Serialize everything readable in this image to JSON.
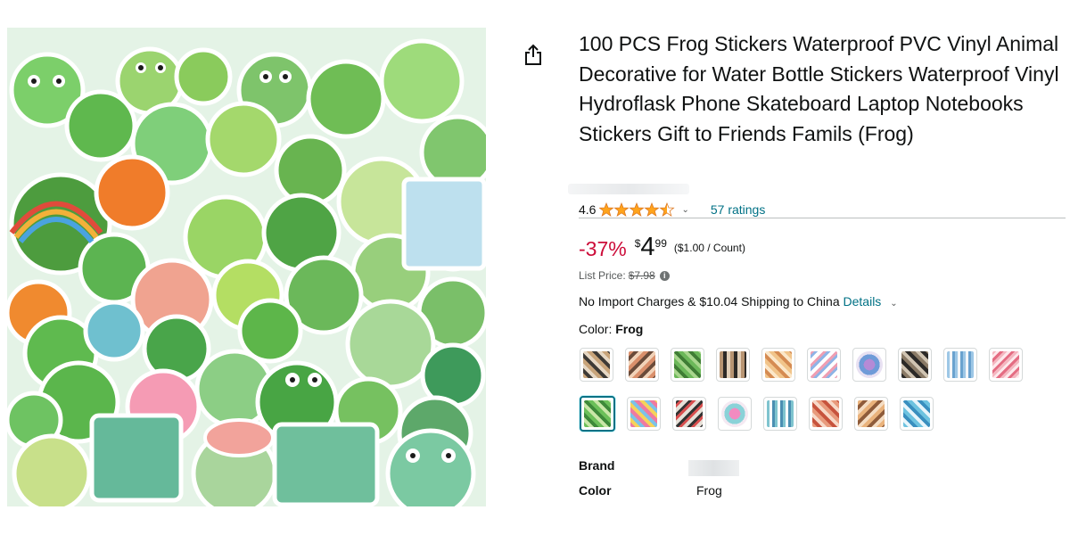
{
  "product": {
    "title": "100 PCS Frog Stickers Waterproof PVC Vinyl Animal Decorative for Water Bottle Stickers Waterproof Vinyl Hydroflask Phone Skateboard Laptop Notebooks Stickers Gift to Friends Famils (Frog)",
    "image_alt": "Frog stickers collage"
  },
  "rating": {
    "value": "4.6",
    "stars": 4.5,
    "count_label": "57 ratings"
  },
  "price": {
    "discount": "-37%",
    "currency": "$",
    "whole": "4",
    "fraction": "99",
    "unit_price": "($1.00 / Count)",
    "list_price_label": "List Price:",
    "list_price": "$7.98"
  },
  "shipping": {
    "text": "No Import Charges & $10.04 Shipping to China ",
    "details_label": "Details"
  },
  "color": {
    "label": "Color: ",
    "selected": "Frog"
  },
  "specs": {
    "brand_label": "Brand",
    "color_label": "Color",
    "color_value": "Frog"
  },
  "colors": {
    "accent_link": "#007185",
    "discount": "#cc0c39",
    "star": "#ffa41c"
  },
  "icons": {
    "share": "share-icon",
    "info": "info-icon",
    "chevron": "chevron-down-icon"
  }
}
